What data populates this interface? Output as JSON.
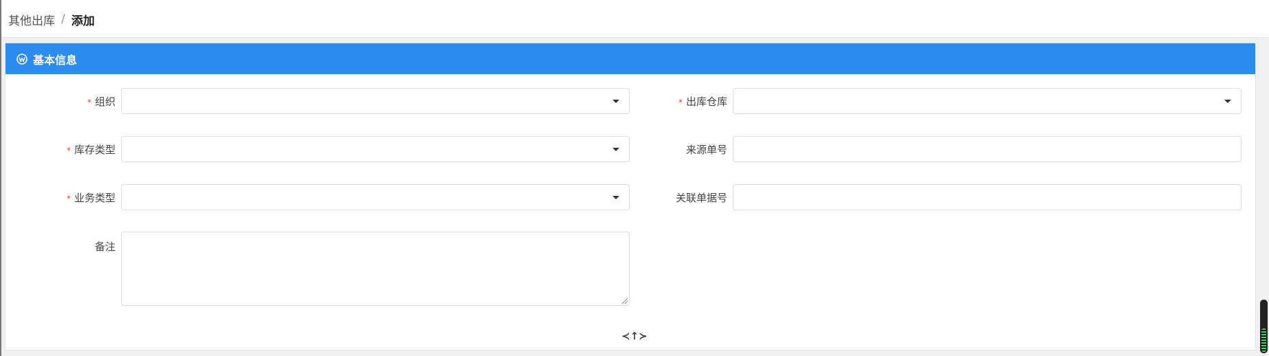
{
  "breadcrumb": {
    "parent": "其他出库",
    "separator": "/",
    "current": "添加"
  },
  "panel": {
    "title": "基本信息",
    "header_color": "#2d8cf0",
    "icon": "wordpress-icon"
  },
  "form": {
    "organization": {
      "label": "组织",
      "required_mark": "*",
      "value": ""
    },
    "outbound_warehouse": {
      "label": "出库仓库",
      "required_mark": "*",
      "value": ""
    },
    "inventory_type": {
      "label": "库存类型",
      "required_mark": "*",
      "value": ""
    },
    "source_order_no": {
      "label": "来源单号",
      "value": ""
    },
    "business_type": {
      "label": "业务类型",
      "required_mark": "*",
      "value": ""
    },
    "related_doc_no": {
      "label": "关联单据号",
      "value": ""
    },
    "remark": {
      "label": "备注",
      "value": ""
    }
  },
  "toggle": {
    "icon": "collapse-toggle-icon",
    "glyph": "≺↑≻"
  },
  "colors": {
    "required": "#ed4014",
    "border": "#dcdee2"
  }
}
